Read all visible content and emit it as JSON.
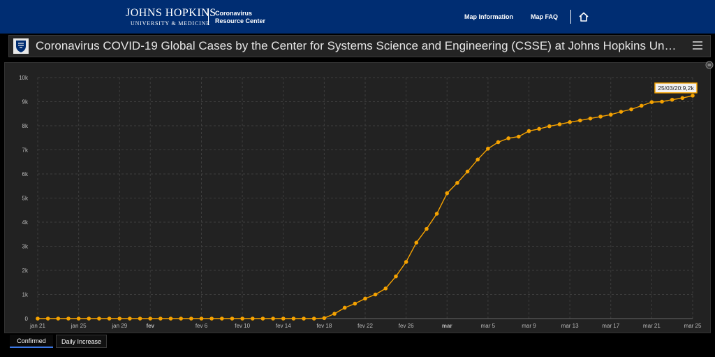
{
  "header": {
    "logo_main": "JOHNS HOPKINS",
    "logo_sub": "UNIVERSITY & MEDICINE",
    "center_line1": "Coronavirus",
    "center_line2": "Resource Center",
    "nav": [
      "Map Information",
      "Map FAQ"
    ],
    "home_icon": "home-icon"
  },
  "dashboard": {
    "title": "Coronavirus COVID-19 Global Cases by the Center for Systems Science and Engineering (CSSE) at Johns Hopkins Un…",
    "menu_icon": "hamburger-menu-icon",
    "logo_icon": "jhu-shield-icon",
    "expand_icon": "expand-icon"
  },
  "tabs": [
    "Confirmed",
    "Daily Increase"
  ],
  "colors": {
    "series": "#f5a200",
    "header_bg": "#002d72",
    "panel_bg": "#222222",
    "active_tab": "#3b78e7"
  },
  "chart_data": {
    "type": "line",
    "x_start": "jan 21",
    "x_end": "mar 25",
    "x_tick_labels": [
      "jan 21",
      "jan 25",
      "jan 29",
      "fev",
      "fev 6",
      "fev 10",
      "fev 14",
      "fev 18",
      "fev 22",
      "fev 26",
      "mar",
      "mar 5",
      "mar 9",
      "mar 13",
      "mar 17",
      "mar 21",
      "mar 25"
    ],
    "x_tick_days": [
      0,
      4,
      8,
      11,
      16,
      20,
      24,
      28,
      32,
      36,
      40,
      44,
      48,
      52,
      56,
      60,
      64
    ],
    "bold_ticks": [
      "fev",
      "mar"
    ],
    "y_ticks": [
      "0",
      "1k",
      "2k",
      "3k",
      "4k",
      "5k",
      "6k",
      "7k",
      "8k",
      "9k",
      "10k"
    ],
    "ylim": [
      0,
      10000
    ],
    "grid": true,
    "tooltip": "25/03/20:9,2k",
    "values": [
      0,
      0,
      0,
      0,
      0,
      0,
      0,
      0,
      0,
      0,
      0,
      0,
      0,
      0,
      0,
      0,
      0,
      0,
      0,
      0,
      0,
      0,
      0,
      0,
      0,
      0,
      0,
      0,
      20,
      200,
      450,
      620,
      830,
      1000,
      1250,
      1750,
      2350,
      3150,
      3720,
      4350,
      5200,
      5630,
      6100,
      6600,
      7050,
      7320,
      7480,
      7550,
      7780,
      7870,
      7980,
      8060,
      8150,
      8220,
      8300,
      8380,
      8460,
      8580,
      8680,
      8830,
      8980,
      9000,
      9080,
      9150,
      9250
    ]
  }
}
